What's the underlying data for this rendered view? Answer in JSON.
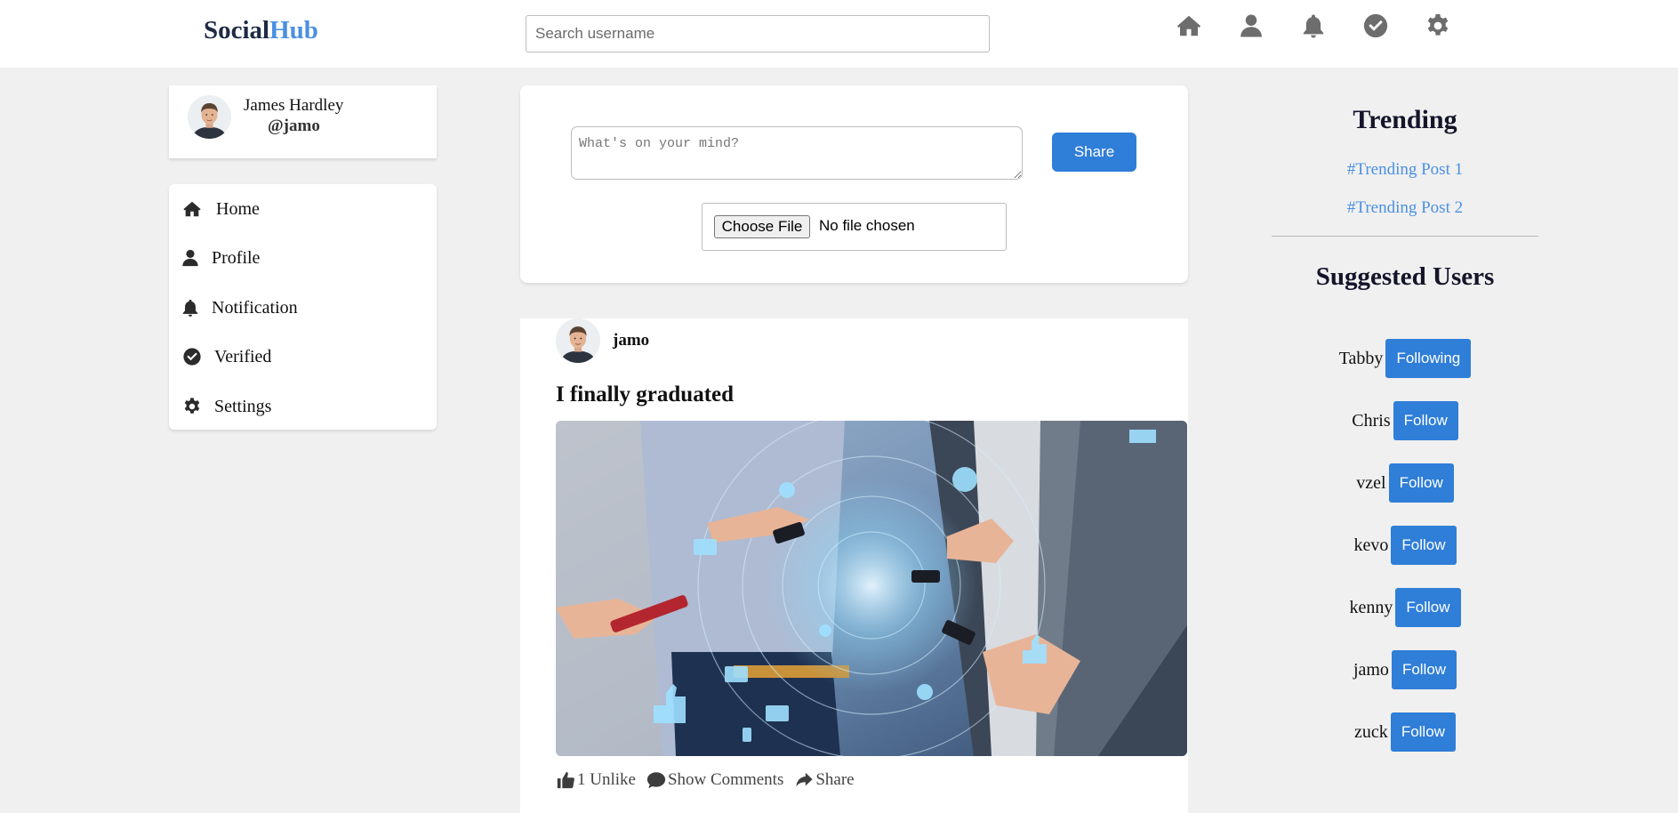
{
  "header": {
    "logo_part1": "Social",
    "logo_part2": "Hub",
    "search_placeholder": "Search username",
    "icons": [
      "home-icon",
      "user-icon",
      "bell-icon",
      "check-circle-icon",
      "gear-icon"
    ]
  },
  "profile": {
    "name": "James Hardley",
    "handle": "@jamo"
  },
  "sidebar": {
    "items": [
      {
        "label": "Home",
        "icon": "home-icon"
      },
      {
        "label": "Profile",
        "icon": "user-icon"
      },
      {
        "label": "Notification",
        "icon": "bell-icon"
      },
      {
        "label": "Verified",
        "icon": "check-circle-icon"
      },
      {
        "label": "Settings",
        "icon": "gear-icon"
      }
    ]
  },
  "composer": {
    "placeholder": "What's on your mind?",
    "share_label": "Share",
    "choose_file_label": "Choose File",
    "file_status": "No file chosen"
  },
  "post": {
    "username": "jamo",
    "title": "I finally graduated",
    "like_count": "1",
    "like_label": "Unlike",
    "comments_label": "Show Comments",
    "share_label": "Share"
  },
  "trending": {
    "title": "Trending",
    "items": [
      "#Trending Post 1",
      "#Trending Post 2"
    ]
  },
  "suggested": {
    "title": "Suggested Users",
    "users": [
      {
        "name": "Tabby",
        "button": "Following"
      },
      {
        "name": "Chris",
        "button": "Follow"
      },
      {
        "name": "vzel",
        "button": "Follow"
      },
      {
        "name": "kevo",
        "button": "Follow"
      },
      {
        "name": "kenny",
        "button": "Follow"
      },
      {
        "name": "jamo",
        "button": "Follow"
      },
      {
        "name": "zuck",
        "button": "Follow"
      }
    ]
  },
  "colors": {
    "accent": "#2f7ed8",
    "logo_dark": "#1f2a44",
    "logo_light": "#4a90e2",
    "link": "#4a90e2",
    "background": "#f0f0f0"
  }
}
